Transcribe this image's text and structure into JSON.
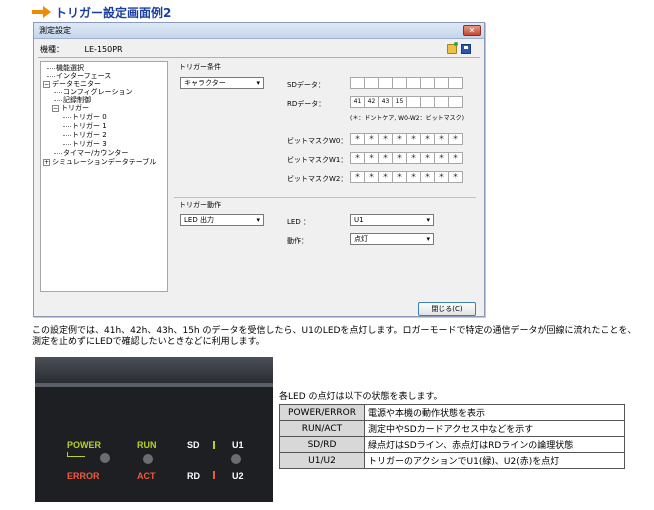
{
  "heading": {
    "title": "トリガー設定画面例2"
  },
  "dialog": {
    "title": "測定設定",
    "model_label": "機種：",
    "model_value": "LE-150PR",
    "tree": [
      "機能選択",
      "インターフェース",
      "データモニター",
      "コンフィグレーション",
      "記録制御",
      "トリガー",
      "トリガー 0",
      "トリガー 1",
      "トリガー 2",
      "トリガー 3",
      "タイマー/カウンター",
      "シミュレーションデータテーブル"
    ],
    "trigger_condition": {
      "label": "トリガー条件",
      "select": "キャラクター",
      "sd_label": "SDデータ：",
      "rd_label": "RDデータ：",
      "rd_values": [
        "41",
        "42",
        "43",
        "15",
        "",
        "",
        "",
        ""
      ],
      "note": "(＊：ドントケア, W0-W2：ビットマスク)",
      "mask_w0_label": "ビットマスクW0：",
      "mask_w1_label": "ビットマスクW1：",
      "mask_w2_label": "ビットマスクW2：",
      "mask_value": "＊"
    },
    "trigger_action": {
      "label": "トリガー動作",
      "select": "LED 出力",
      "led_label": "LED ：",
      "led_value": "U1",
      "action_label": "動作：",
      "action_value": "点灯"
    },
    "close_button": "閉じる(C)"
  },
  "caption": "この設定例では、41h、42h、43h、15h のデータを受信したら、U1のLEDを点灯します。ロガーモードで特定の通信データが回線に流れたことを、測定を止めずにLEDで確認したいときなどに利用します。",
  "photo": {
    "power": "POWER",
    "error": "ERROR",
    "run": "RUN",
    "act": "ACT",
    "sd": "SD",
    "rd": "RD",
    "u1": "U1",
    "u2": "U2",
    "colors": {
      "green": "#b7d12b",
      "red": "#f05a3c",
      "white": "#ffffff"
    }
  },
  "led_table": {
    "intro": "各LED の点灯は以下の状態を表します。",
    "rows": [
      {
        "key": "POWER/ERROR",
        "value": "電源や本機の動作状態を表示"
      },
      {
        "key": "RUN/ACT",
        "value": "測定中やSDカードアクセス中などを示す"
      },
      {
        "key": "SD/RD",
        "value": "緑点灯はSDライン、赤点灯はRDラインの論理状態"
      },
      {
        "key": "U1/U2",
        "value": "トリガーのアクションでU1(緑)、U2(赤)を点灯"
      }
    ]
  }
}
